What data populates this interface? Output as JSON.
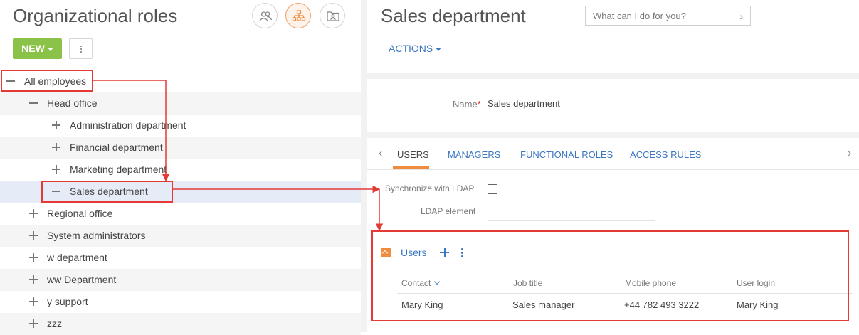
{
  "left": {
    "title": "Organizational roles",
    "view_buttons": [
      {
        "icon": "users-icon",
        "active": false
      },
      {
        "icon": "org-chart-icon",
        "active": true
      },
      {
        "icon": "id-card-icon",
        "active": false
      }
    ],
    "new_label": "NEW",
    "tree": [
      {
        "label": "All employees",
        "level": 0,
        "expanded": true,
        "alt": false,
        "selected": false
      },
      {
        "label": "Head office",
        "level": 1,
        "expanded": true,
        "alt": true,
        "selected": false
      },
      {
        "label": "Administration department",
        "level": 2,
        "expanded": false,
        "alt": false,
        "selected": false
      },
      {
        "label": "Financial department",
        "level": 2,
        "expanded": false,
        "alt": true,
        "selected": false
      },
      {
        "label": "Marketing department",
        "level": 2,
        "expanded": false,
        "alt": false,
        "selected": false
      },
      {
        "label": "Sales department",
        "level": 2,
        "expanded": true,
        "alt": false,
        "selected": true
      },
      {
        "label": "Regional office",
        "level": 1,
        "expanded": false,
        "alt": false,
        "selected": false
      },
      {
        "label": "System administrators",
        "level": 1,
        "expanded": false,
        "alt": true,
        "selected": false
      },
      {
        "label": "w department",
        "level": 1,
        "expanded": false,
        "alt": false,
        "selected": false
      },
      {
        "label": "ww Department",
        "level": 1,
        "expanded": false,
        "alt": true,
        "selected": false
      },
      {
        "label": "y support",
        "level": 1,
        "expanded": false,
        "alt": false,
        "selected": false
      },
      {
        "label": "zzz",
        "level": 1,
        "expanded": false,
        "alt": true,
        "selected": false
      }
    ]
  },
  "right": {
    "title": "Sales department",
    "search_placeholder": "What can I do for you?",
    "actions_label": "ACTIONS",
    "name_label": "Name",
    "name_required_mark": "*",
    "name_value": "Sales department",
    "tabs": [
      "USERS",
      "MANAGERS",
      "FUNCTIONAL ROLES",
      "ACCESS RULES"
    ],
    "active_tab": "USERS",
    "sync_ldap_label": "Synchronize with LDAP",
    "ldap_element_label": "LDAP element",
    "users_detail": {
      "title": "Users",
      "columns": [
        "Contact",
        "Job title",
        "Mobile phone",
        "User login"
      ],
      "rows": [
        {
          "contact": "Mary King",
          "job_title": "Sales manager",
          "mobile_phone": "+44 782 493 3222",
          "user_login": "Mary King"
        }
      ]
    }
  },
  "colors": {
    "accent_orange": "#f08c3e",
    "link_blue": "#3d77c1",
    "new_green": "#8bc34a",
    "highlight_red": "#e53935",
    "selected_row": "#e6ecf7"
  }
}
